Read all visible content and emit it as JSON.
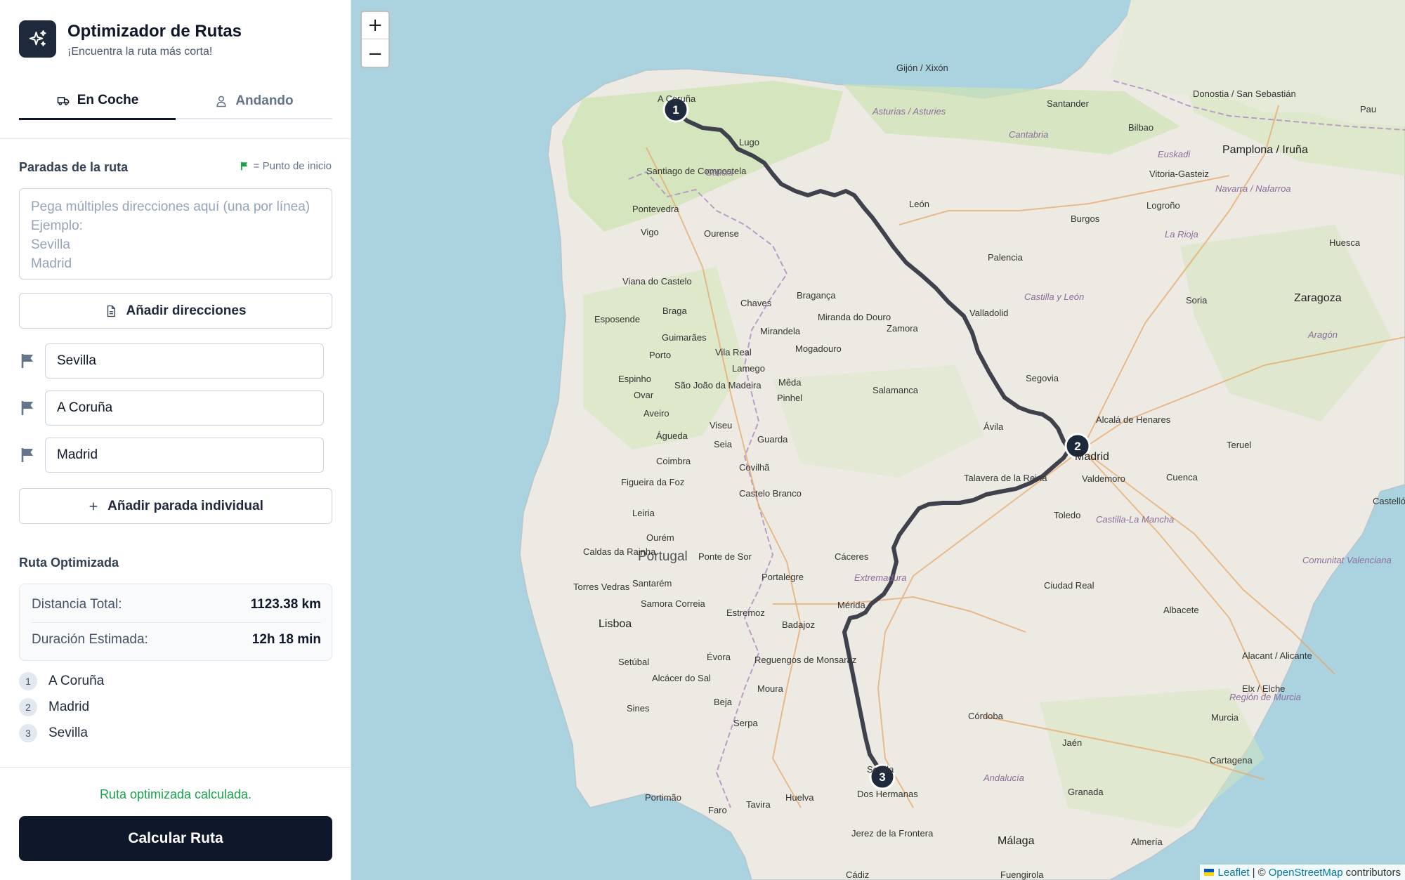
{
  "app": {
    "title": "Optimizador de Rutas",
    "subtitle": "¡Encuentra la ruta más corta!",
    "logo_icon": "sparkles-icon"
  },
  "tabs": [
    {
      "label": "En Coche",
      "icon": "car-icon",
      "active": true
    },
    {
      "label": "Andando",
      "icon": "person-icon",
      "active": false
    }
  ],
  "stops_section": {
    "title": "Paradas de la ruta",
    "legend": "= Punto de inicio",
    "legend_color": "#16a34a",
    "paste_placeholder": "Pega múltiples direcciones aquí (una por línea)\nEjemplo:\nSevilla\nMadrid",
    "add_addresses_label": "Añadir direcciones",
    "stops": [
      "Sevilla",
      "A Coruña",
      "Madrid"
    ],
    "add_single_label": "Añadir parada individual"
  },
  "optimized": {
    "title": "Ruta Optimizada",
    "distance_label": "Distancia Total:",
    "distance_value": "1123.38 km",
    "duration_label": "Duración Estimada:",
    "duration_value": "12h 18 min",
    "order": [
      {
        "num": "1",
        "name": "A Coruña"
      },
      {
        "num": "2",
        "name": "Madrid"
      },
      {
        "num": "3",
        "name": "Sevilla"
      }
    ]
  },
  "status": "Ruta optimizada calculada.",
  "calculate_label": "Calcular Ruta",
  "map": {
    "zoom_in": "+",
    "zoom_out": "−",
    "attribution": {
      "leaflet": "Leaflet",
      "sep": "| ©",
      "osm": "OpenStreetMap",
      "contributors": "contributors"
    },
    "markers": [
      "1",
      "2",
      "3"
    ],
    "country_label": "Portugal",
    "cities": [
      "A Coruña",
      "Lugo",
      "Santiago de Compostela",
      "Pontevedra",
      "Vigo",
      "Ourense",
      "Gijón / Xixón",
      "Santander",
      "Bilbao",
      "Donostia / San Sebastián",
      "Pamplona / Iruña",
      "Vitoria-Gasteiz",
      "Logroño",
      "Burgos",
      "León",
      "Palencia",
      "Valladolid",
      "Zamora",
      "Salamanca",
      "Segovia",
      "Ávila",
      "Madrid",
      "Alcalá de Henares",
      "Valdemoro",
      "Toledo",
      "Talavera de la Reina",
      "Cáceres",
      "Mérida",
      "Badajoz",
      "Sevilla",
      "Dos Hermanas",
      "Huelva",
      "Jerez de la Frontera",
      "Cádiz",
      "Córdoba",
      "Jaén",
      "Granada",
      "Málaga",
      "Almería",
      "Murcia",
      "Cartagena",
      "Elx / Elche",
      "Alacant / Alicante",
      "Albacete",
      "Ciudad Real",
      "Cuenca",
      "Teruel",
      "Zaragoza",
      "Huesca",
      "Soria",
      "Pau",
      "Braga",
      "Porto",
      "Viseu",
      "Coimbra",
      "Leiria",
      "Lisboa",
      "Setúbal",
      "Évora",
      "Beja",
      "Faro",
      "Sines",
      "Portimão",
      "Tavira",
      "Bragança",
      "Chaves",
      "Guarda",
      "Aveiro",
      "Castelo Branco",
      "Portalegre",
      "Estremoz",
      "Serpa",
      "Moura",
      "Lamego",
      "Mogadouro",
      "Esposende",
      "Espinho",
      "Ovar",
      "Seia",
      "Covilhã",
      "Ourém",
      "Caldas da Rainha",
      "Torres Vedras",
      "Santarém",
      "Samora Correia",
      "Alcácer do Sal",
      "Ponte de Sor",
      "Reguengos de Monsaraz",
      "Vila Real",
      "Mirandela",
      "Miranda do Douro",
      "Mêda",
      "Pinhel",
      "Guimarães",
      "São João da Madeira",
      "Águeda",
      "Figueira da Foz",
      "Viana do Castelo",
      "Castellón de la Plana",
      "Fuengirola"
    ],
    "regions": [
      "Asturias / Asturies",
      "Cantabria",
      "Euskadi",
      "Navarra / Nafarroa",
      "La Rioja",
      "Galicia",
      "Castilla y León",
      "Aragón",
      "Comunitat Valenciana",
      "Región de Murcia",
      "Andalucía",
      "Extremadura",
      "Castilla-La Mancha"
    ]
  },
  "colors": {
    "primary": "#0f172a",
    "accent_green": "#16a34a",
    "route": "#3f424d",
    "sea": "#aad3df",
    "land": "#eceae2"
  }
}
